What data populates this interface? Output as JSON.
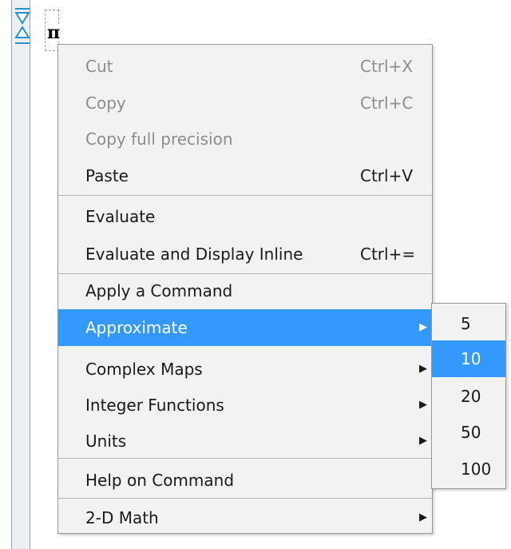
{
  "document": {
    "symbol": "π"
  },
  "context_menu": {
    "items": [
      {
        "label": "Cut",
        "shortcut": "Ctrl+X",
        "state": "disabled"
      },
      {
        "label": "Copy",
        "shortcut": "Ctrl+C",
        "state": "disabled"
      },
      {
        "label": "Copy full precision",
        "shortcut": "",
        "state": "disabled"
      },
      {
        "label": "Paste",
        "shortcut": "Ctrl+V",
        "state": "enabled"
      },
      {
        "label": "Evaluate",
        "shortcut": "",
        "state": "enabled"
      },
      {
        "label": "Evaluate and Display Inline",
        "shortcut": "Ctrl+=",
        "state": "enabled"
      },
      {
        "label": "Apply a Command",
        "shortcut": "",
        "state": "enabled"
      },
      {
        "label": "Approximate",
        "shortcut": "",
        "state": "highlighted",
        "has_submenu": true
      },
      {
        "label": "Complex Maps",
        "shortcut": "",
        "state": "enabled",
        "has_submenu": true
      },
      {
        "label": "Integer Functions",
        "shortcut": "",
        "state": "enabled",
        "has_submenu": true
      },
      {
        "label": "Units",
        "shortcut": "",
        "state": "enabled",
        "has_submenu": true
      },
      {
        "label": "Help on Command",
        "shortcut": "",
        "state": "enabled"
      },
      {
        "label": "2-D Math",
        "shortcut": "",
        "state": "enabled",
        "has_submenu": true
      }
    ]
  },
  "approximate_submenu": {
    "items": [
      {
        "label": "5",
        "state": "enabled"
      },
      {
        "label": "10",
        "state": "highlighted"
      },
      {
        "label": "20",
        "state": "enabled"
      },
      {
        "label": "50",
        "state": "enabled"
      },
      {
        "label": "100",
        "state": "enabled"
      }
    ]
  },
  "icons": {
    "collapse": "triangle-down-icon",
    "expand": "triangle-up-icon",
    "submenu": "triangle-right-icon"
  },
  "colors": {
    "highlight": "#3399ff",
    "menu_background": "#f2f2f2",
    "disabled_text": "#8c8c8c",
    "gutter_icon": "#2b8fd6"
  }
}
